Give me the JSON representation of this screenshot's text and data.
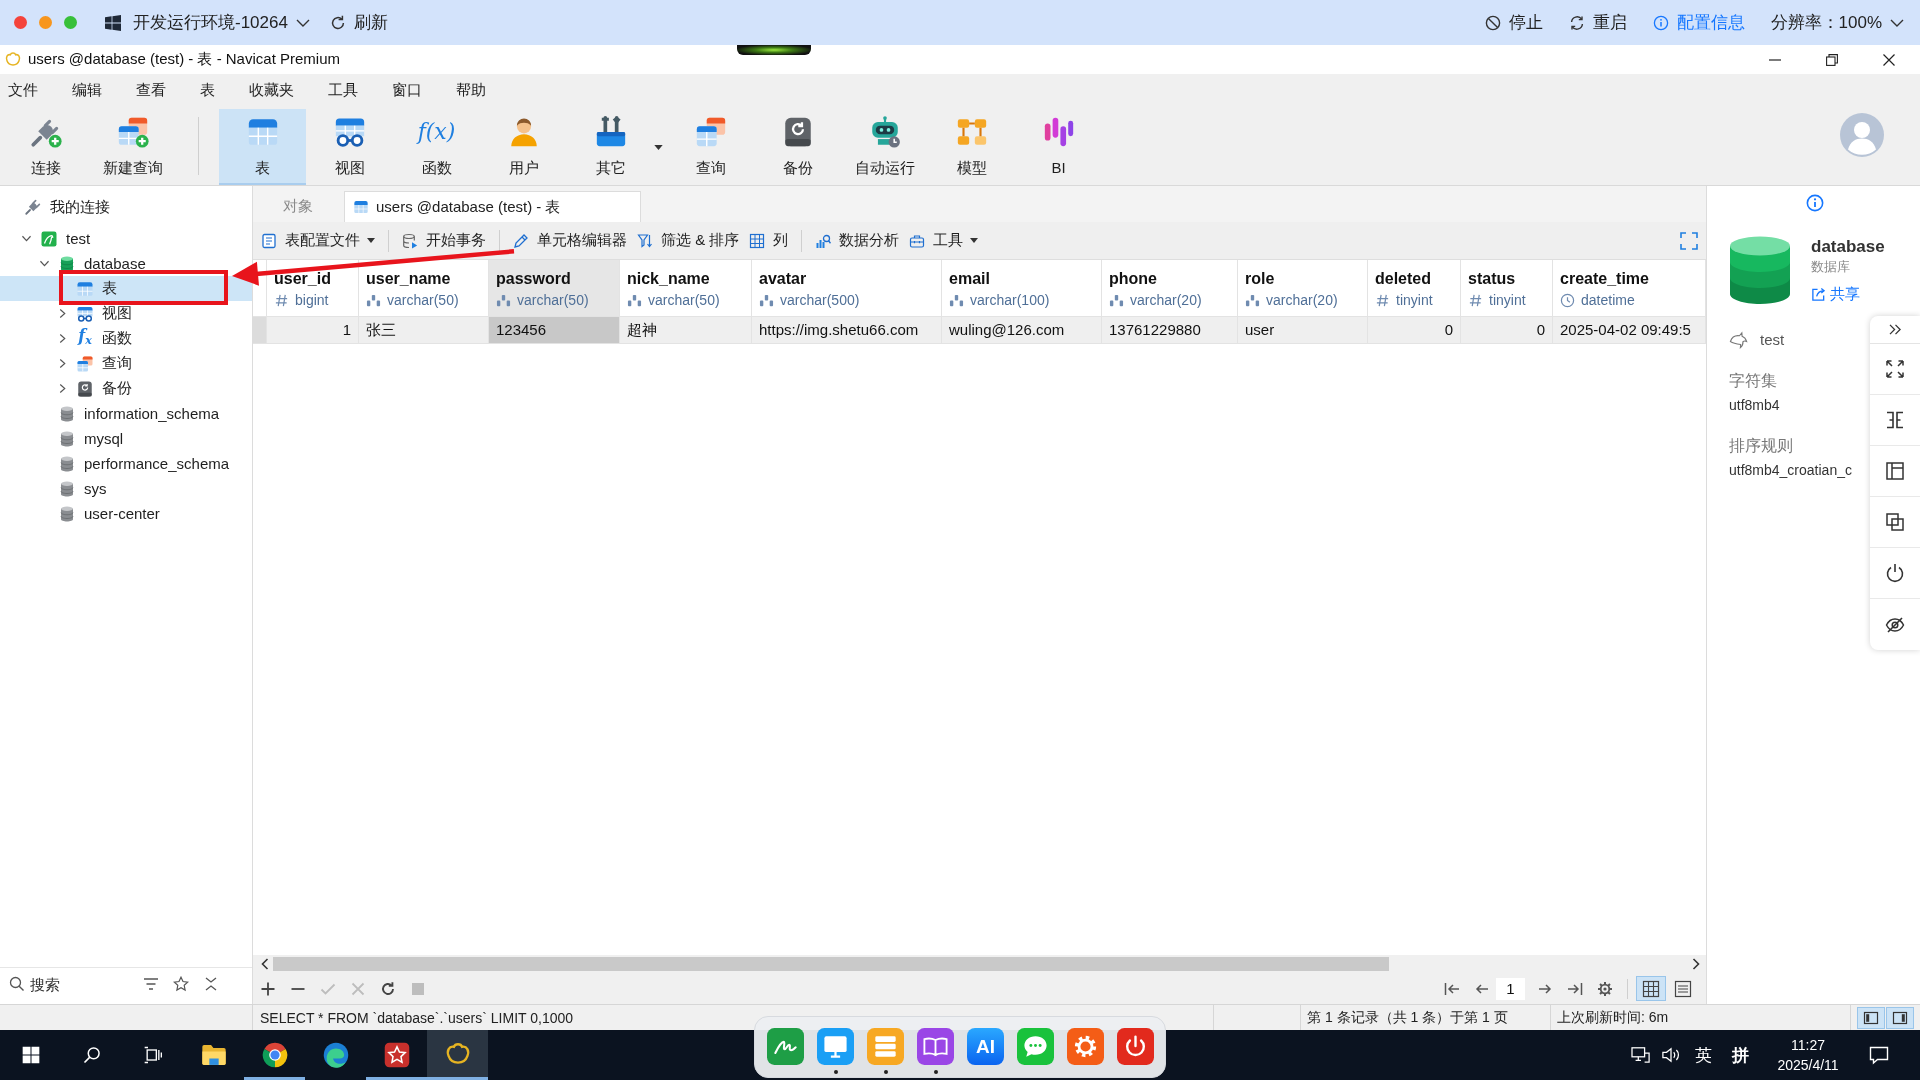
{
  "env_bar": {
    "environment": "开发运行环境-10264",
    "refresh": "刷新",
    "actions": [
      {
        "kind": "stop",
        "label": "停止"
      },
      {
        "kind": "restart",
        "label": "重启"
      },
      {
        "kind": "info",
        "label": "配置信息"
      }
    ],
    "resolution": "分辨率：100%"
  },
  "window": {
    "title": "users @database (test) - 表 - Navicat Premium"
  },
  "menu": [
    "文件",
    "编辑",
    "查看",
    "表",
    "收藏夹",
    "工具",
    "窗口",
    "帮助"
  ],
  "toolbar": {
    "groups": [
      [
        {
          "kind": "connect",
          "label": "连接",
          "selected": false,
          "dropdown": false
        },
        {
          "kind": "new_query",
          "label": "新建查询",
          "selected": false,
          "dropdown": false
        }
      ],
      [
        {
          "kind": "table",
          "label": "表",
          "selected": true,
          "dropdown": false
        },
        {
          "kind": "view",
          "label": "视图",
          "selected": false,
          "dropdown": false
        },
        {
          "kind": "function",
          "label": "函数",
          "glyph": "f(x)",
          "selected": false,
          "dropdown": false
        },
        {
          "kind": "user",
          "label": "用户",
          "selected": false,
          "dropdown": false
        },
        {
          "kind": "other",
          "label": "其它",
          "selected": false,
          "dropdown": true
        },
        {
          "kind": "query",
          "label": "查询",
          "selected": false,
          "dropdown": false
        },
        {
          "kind": "backup",
          "label": "备份",
          "selected": false,
          "dropdown": false
        },
        {
          "kind": "automation",
          "label": "自动运行",
          "selected": false,
          "dropdown": false
        },
        {
          "kind": "model",
          "label": "模型",
          "selected": false,
          "dropdown": false
        },
        {
          "kind": "bi",
          "label": "BI",
          "selected": false,
          "dropdown": false
        }
      ]
    ]
  },
  "sidebar": {
    "header": "我的连接",
    "tree": [
      {
        "kind": "connection",
        "label": "test",
        "expanded": true,
        "selected": false,
        "children": [
          {
            "kind": "database",
            "label": "database",
            "open": true,
            "expanded": true,
            "selected": false,
            "children": [
              {
                "kind": "tables",
                "label": "表",
                "selected": true
              },
              {
                "kind": "views",
                "label": "视图",
                "expanded": false,
                "selected": false
              },
              {
                "kind": "functions",
                "label": "函数",
                "glyph": "f$_{x}$",
                "expanded": false,
                "selected": false
              },
              {
                "kind": "queries",
                "label": "查询",
                "expanded": false,
                "selected": false
              },
              {
                "kind": "backups",
                "label": "备份",
                "expanded": false,
                "selected": false
              }
            ]
          },
          {
            "kind": "database",
            "label": "information_schema",
            "open": false,
            "selected": false
          },
          {
            "kind": "database",
            "label": "mysql",
            "open": false,
            "selected": false
          },
          {
            "kind": "database",
            "label": "performance_schema",
            "open": false,
            "selected": false
          },
          {
            "kind": "database",
            "label": "sys",
            "open": false,
            "selected": false
          },
          {
            "kind": "database",
            "label": "user-center",
            "open": false,
            "selected": false
          }
        ]
      }
    ],
    "search": {
      "placeholder": "搜索"
    }
  },
  "tabs": [
    {
      "kind": "objects",
      "label": "对象",
      "selected": false
    },
    {
      "kind": "table",
      "label": "users @database (test) - 表",
      "selected": true
    }
  ],
  "object_toolbar": {
    "groups": [
      [
        {
          "kind": "profile",
          "label": "表配置文件",
          "dropdown": true
        }
      ],
      [
        {
          "kind": "transaction",
          "label": "开始事务",
          "dropdown": false
        }
      ],
      [
        {
          "kind": "cell_editor",
          "label": "单元格编辑器",
          "dropdown": false
        },
        {
          "kind": "filter_sort",
          "label": "筛选 & 排序",
          "dropdown": false
        },
        {
          "kind": "columns",
          "label": "列",
          "dropdown": false
        }
      ],
      [
        {
          "kind": "analysis",
          "label": "数据分析",
          "dropdown": false
        },
        {
          "kind": "tools",
          "label": "工具",
          "dropdown": true
        }
      ]
    ]
  },
  "table": {
    "columns": [
      {
        "name": "user_id",
        "type": "bigint",
        "kind": "number",
        "selected": false
      },
      {
        "name": "user_name",
        "type": "varchar(50)",
        "kind": "text",
        "selected": false
      },
      {
        "name": "password",
        "type": "varchar(50)",
        "kind": "text",
        "selected": true
      },
      {
        "name": "nick_name",
        "type": "varchar(50)",
        "kind": "text",
        "selected": false
      },
      {
        "name": "avatar",
        "type": "varchar(500)",
        "kind": "text",
        "selected": false
      },
      {
        "name": "email",
        "type": "varchar(100)",
        "kind": "text",
        "selected": false
      },
      {
        "name": "phone",
        "type": "varchar(20)",
        "kind": "text",
        "selected": false
      },
      {
        "name": "role",
        "type": "varchar(20)",
        "kind": "text",
        "selected": false
      },
      {
        "name": "deleted",
        "type": "tinyint",
        "kind": "number",
        "selected": false
      },
      {
        "name": "status",
        "type": "tinyint",
        "kind": "number",
        "selected": false
      },
      {
        "name": "create_time",
        "type": "datetime",
        "kind": "datetime",
        "selected": false
      }
    ],
    "rows": [
      {
        "selected": true,
        "cells": [
          "1",
          "张三",
          "123456",
          "超神",
          "https://img.shetu66.com",
          "wuling@126.com",
          "13761229880",
          "user",
          "0",
          "0",
          "2025-04-02 09:49:5"
        ]
      }
    ]
  },
  "record_actions": [
    {
      "kind": "add",
      "disabled": false
    },
    {
      "kind": "remove",
      "disabled": false
    },
    {
      "kind": "apply",
      "disabled": true
    },
    {
      "kind": "discard",
      "disabled": true
    },
    {
      "kind": "refresh",
      "disabled": false
    },
    {
      "kind": "stop",
      "disabled": true
    }
  ],
  "pager": {
    "page": "1"
  },
  "views": [
    {
      "kind": "grid",
      "selected": true
    },
    {
      "kind": "form",
      "selected": false
    }
  ],
  "object_panel": {
    "name": "database",
    "type": "数据库",
    "share": "共享",
    "connection": "test",
    "properties": [
      {
        "label": "字符集",
        "value": "utf8mb4"
      },
      {
        "label": "排序规则",
        "value": "utf8mb4_croatian_c"
      }
    ]
  },
  "status_bar": {
    "sql": "SELECT * FROM `database`.`users` LIMIT 0,1000",
    "record_info": "第 1 条记录（共 1 条）于第 1 页",
    "refresh_time": "上次刷新时间: 6m",
    "panes": [
      {
        "kind": "left",
        "selected": true
      },
      {
        "kind": "right",
        "selected": true
      }
    ]
  },
  "taskbar": {
    "buttons": [
      {
        "kind": "start"
      },
      {
        "kind": "search"
      },
      {
        "kind": "task_view"
      }
    ],
    "apps": [
      {
        "kind": "folder",
        "running": false,
        "selected": false
      },
      {
        "kind": "ring_browser",
        "running": true,
        "selected": false
      },
      {
        "kind": "swirl_browser",
        "running": false,
        "selected": false
      },
      {
        "kind": "star_app",
        "running": true,
        "selected": false
      },
      {
        "kind": "database_app",
        "running": true,
        "selected": true
      }
    ],
    "tray": {
      "language": "英",
      "ime": "拼",
      "time": "11:27",
      "date": "2025/4/11"
    }
  },
  "dock": [
    {
      "kind": "sign",
      "running": false
    },
    {
      "kind": "monitor",
      "running": true
    },
    {
      "kind": "server",
      "running": true
    },
    {
      "kind": "book",
      "running": true
    },
    {
      "kind": "ai",
      "label": "AI",
      "running": false
    },
    {
      "kind": "chat",
      "running": false
    },
    {
      "kind": "settings",
      "running": false
    },
    {
      "kind": "power",
      "running": false
    }
  ]
}
